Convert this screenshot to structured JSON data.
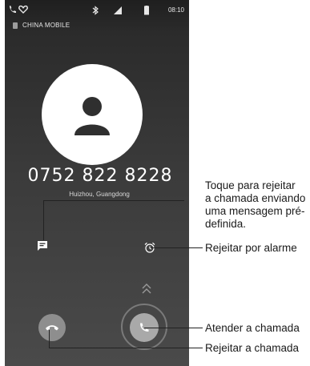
{
  "status_bar": {
    "time": "08:10",
    "icons_left": [
      "phone-icon",
      "heart-icon"
    ],
    "icons_right": [
      "bluetooth-icon",
      "signal-icon",
      "battery-icon"
    ]
  },
  "carrier": "CHINA MOBILE",
  "call": {
    "number": "0752 822 8228",
    "location": "Huizhou, Guangdong"
  },
  "actions": {
    "message_icon": "message-icon",
    "alarm_icon": "alarm-icon",
    "swipe_icon": "chevron-up-icon",
    "reject_icon": "hangup-icon",
    "answer_icon": "phone-icon"
  },
  "callouts": {
    "message": [
      "Toque para rejeitar",
      "a chamada enviando",
      "uma mensagem pré-",
      "definida."
    ],
    "alarm": "Rejeitar por alarme",
    "answer": "Atender a chamada",
    "reject": "Rejeitar a chamada"
  }
}
